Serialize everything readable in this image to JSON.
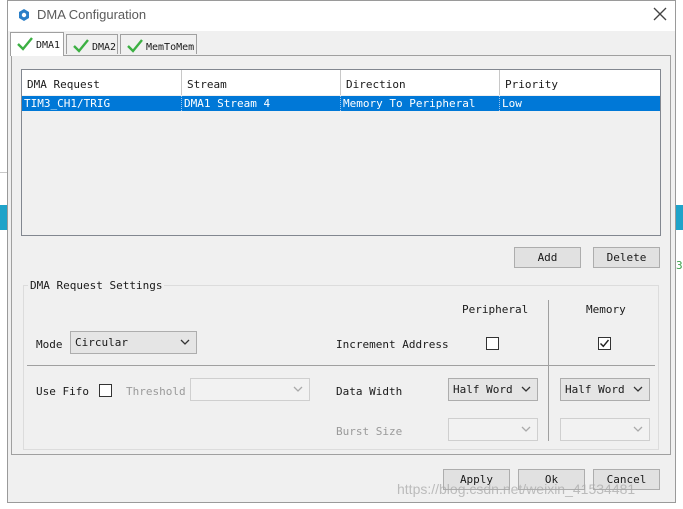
{
  "window": {
    "title": "DMA Configuration"
  },
  "tabs": [
    {
      "label": "DMA1",
      "active": true
    },
    {
      "label": "DMA2",
      "active": false
    },
    {
      "label": "MemToMem",
      "active": false
    }
  ],
  "table": {
    "headers": [
      "DMA Request",
      "Stream",
      "Direction",
      "Priority"
    ],
    "rows": [
      [
        "TIM3_CH1/TRIG",
        "DMA1 Stream 4",
        "Memory To Peripheral",
        "Low"
      ]
    ]
  },
  "buttons": {
    "add": "Add",
    "delete": "Delete",
    "apply": "Apply",
    "ok": "Ok",
    "cancel": "Cancel"
  },
  "settings": {
    "group_title": "DMA Request Settings",
    "col_peripheral": "Peripheral",
    "col_memory": "Memory",
    "mode_label": "Mode",
    "mode_value": "Circular",
    "increment_label": "Increment Address",
    "increment_peripheral": false,
    "increment_memory": true,
    "use_fifo_label": "Use Fifo",
    "use_fifo": false,
    "threshold_label": "Threshold",
    "threshold_value": "",
    "data_width_label": "Data Width",
    "data_width_peripheral": "Half Word",
    "data_width_memory": "Half Word",
    "burst_size_label": "Burst Size",
    "burst_peripheral": "",
    "burst_memory": ""
  },
  "background_fragment": "3",
  "watermark": "https://blog.csdn.net/weixin_41534481",
  "colors": {
    "selection": "#0078d7",
    "check": "#3cb043",
    "accent": "#1fa3c9"
  }
}
